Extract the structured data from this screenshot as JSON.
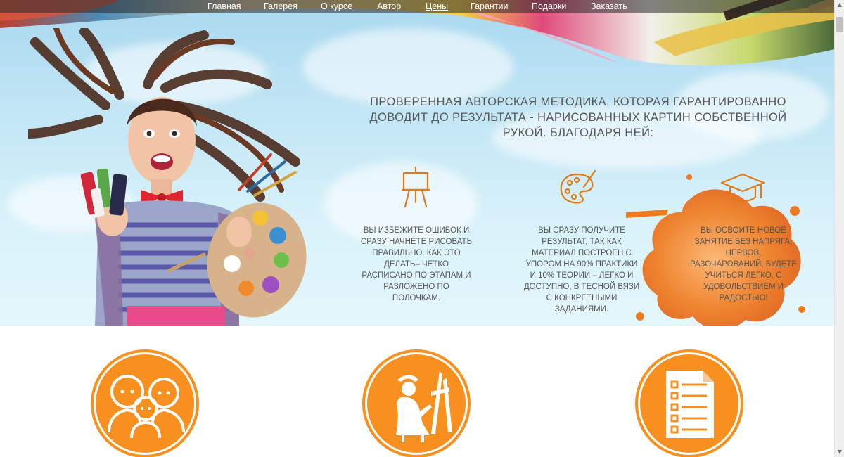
{
  "nav": {
    "items": [
      "Главная",
      "Галерея",
      "О курсе",
      "Автор",
      "Цены",
      "Гарантии",
      "Подарки",
      "Заказать"
    ],
    "active": "Цены"
  },
  "hero": {
    "headline": "Проверенная авторская методика, которая гарантированно доводит до результата - нарисованных картин собственной рукой. Благодаря ней:"
  },
  "features": [
    {
      "icon": "easel-icon",
      "text": "Вы избежите ошибок и сразу начнете рисовать правильно. Как это делать– четко расписано по этапам и разложено по полочкам."
    },
    {
      "icon": "palette-icon",
      "text": "Вы сразу получите результат, так как материал построен с упором на 90% практики и 10% теории – легко и доступно, в тесной вязи с конкретными заданиями."
    },
    {
      "icon": "graduation-cap-icon",
      "text": "Вы освоите новое занятие без напряга, нервов, разочарований, будете учиться легко, с удовольствием и радостью!"
    }
  ],
  "circles": [
    {
      "icon": "family-icon"
    },
    {
      "icon": "painter-icon"
    },
    {
      "icon": "checklist-icon"
    }
  ],
  "colors": {
    "accent": "#f7901e",
    "text": "#555555",
    "icon": "#e07b17"
  },
  "scrollbar": {
    "up": "▲",
    "down": "▼"
  }
}
